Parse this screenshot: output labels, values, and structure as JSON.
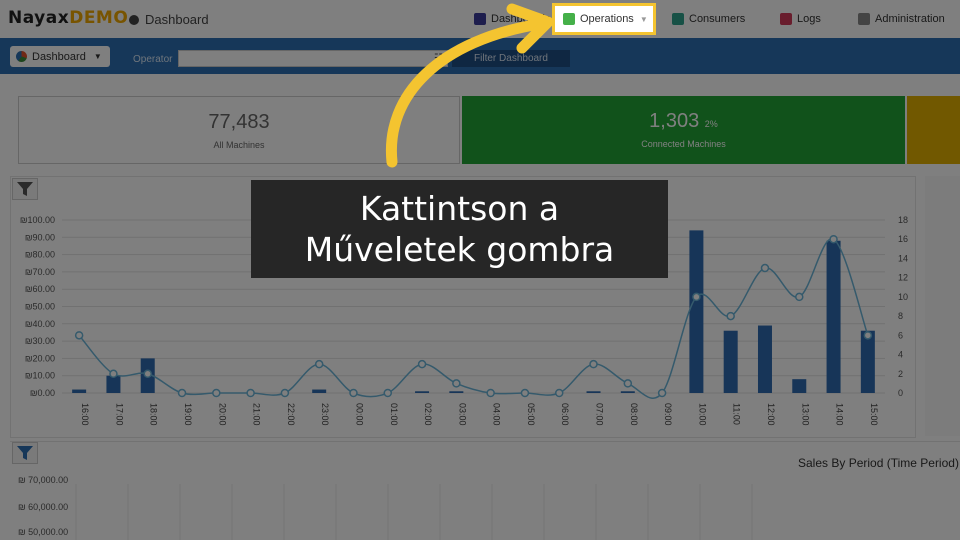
{
  "header": {
    "logo_brand": "Nayax",
    "logo_demo": "DEMO",
    "page_title": "Dashboard",
    "nav": [
      {
        "label": "Dashboards",
        "icon": "chart-icon",
        "color": "#3a3a9a"
      },
      {
        "label": "Operations",
        "icon": "operations-icon",
        "color": "#45b049"
      },
      {
        "label": "Consumers",
        "icon": "consumers-icon",
        "color": "#2fa38c"
      },
      {
        "label": "Logs",
        "icon": "logs-icon",
        "color": "#d23a5a"
      },
      {
        "label": "Administration",
        "icon": "administration-icon",
        "color": "#888888"
      }
    ]
  },
  "toolbar": {
    "dashboard_dropdown": "Dashboard",
    "operator_label": "Operator",
    "operator_value": "",
    "filter_button": "Filter Dashboard"
  },
  "kpis": {
    "all_machines_value": "77,483",
    "all_machines_label": "All Machines",
    "connected_value": "1,303",
    "connected_pct": "2%",
    "connected_label": "Connected Machines"
  },
  "chart_data": [
    {
      "type": "bar",
      "categories": [
        "16:00",
        "17:00",
        "18:00",
        "19:00",
        "20:00",
        "21:00",
        "22:00",
        "23:00",
        "00:00",
        "01:00",
        "02:00",
        "03:00",
        "04:00",
        "05:00",
        "06:00",
        "07:00",
        "08:00",
        "09:00",
        "10:00",
        "11:00",
        "12:00",
        "13:00",
        "14:00",
        "15:00"
      ],
      "ylim": [
        0,
        100
      ],
      "y2lim": [
        0,
        18
      ],
      "y_ticks": [
        "₪0.00",
        "₪10.00",
        "₪20.00",
        "₪30.00",
        "₪40.00",
        "₪50.00",
        "₪60.00",
        "₪70.00",
        "₪80.00",
        "₪90.00",
        "₪100.00"
      ],
      "y2_ticks": [
        "0",
        "2",
        "4",
        "6",
        "8",
        "10",
        "12",
        "14",
        "16",
        "18"
      ],
      "series": [
        {
          "values": [
            2,
            10,
            20,
            0,
            0,
            0,
            0,
            2,
            0,
            0,
            1,
            1,
            0,
            0,
            0,
            1,
            1,
            0,
            94,
            36,
            39,
            8,
            88,
            36
          ]
        },
        {
          "type": "line",
          "values": [
            6,
            2,
            2,
            0,
            0,
            0,
            0,
            3,
            0,
            0,
            3,
            1,
            0,
            0,
            0,
            3,
            1,
            0,
            10,
            8,
            13,
            10,
            16,
            6
          ]
        }
      ],
      "colors": {
        "bar": "#2f6bb0",
        "line": "#6ab4d8"
      }
    },
    {
      "type": "bar",
      "title": "Sales By Period (Time Period)",
      "y_ticks": [
        "₪ 50,000.00",
        "₪ 60,000.00",
        "₪ 70,000.00"
      ]
    }
  ],
  "callout": {
    "line1": "Kattintson a",
    "line2": "Műveletek gombra"
  },
  "colors": {
    "accent": "#2c6fb3",
    "highlight": "#f4c430",
    "connected": "#22a436"
  }
}
